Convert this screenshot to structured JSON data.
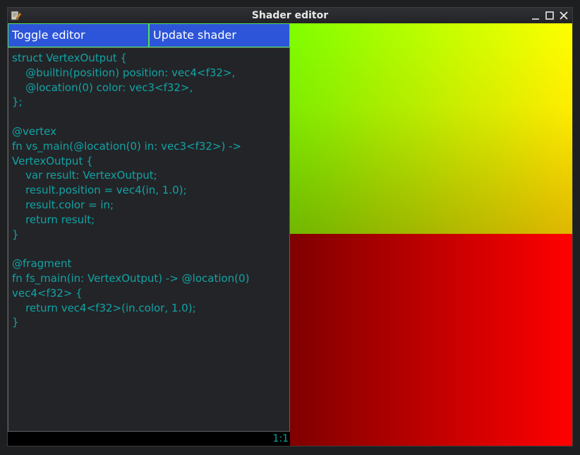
{
  "window": {
    "title": "Shader editor",
    "minimize_icon": "minimize-icon",
    "maximize_icon": "maximize-icon",
    "close_icon": "close-icon"
  },
  "editor": {
    "toggle_label": "Toggle editor",
    "update_label": "Update shader",
    "code_lines": [
      "struct VertexOutput {",
      "    @builtin(position) position: vec4<f32>,",
      "    @location(0) color: vec3<f32>,",
      "};",
      "",
      "@vertex",
      "fn vs_main(@location(0) in: vec3<f32>) ->",
      "VertexOutput {",
      "    var result: VertexOutput;",
      "    result.position = vec4(in, 1.0);",
      "    result.color = in;",
      "    return result;",
      "}",
      "",
      "@fragment",
      "fn fs_main(in: VertexOutput) -> @location(0)",
      "vec4<f32> {",
      "    return vec4<f32>(in.color, 1.0);",
      "}"
    ],
    "cursor_position": "1:1"
  },
  "colors": {
    "button_bg": "#2d55d9",
    "button_border": "#4fe05a",
    "code_text": "#12a3a3",
    "editor_bg": "#232428"
  }
}
